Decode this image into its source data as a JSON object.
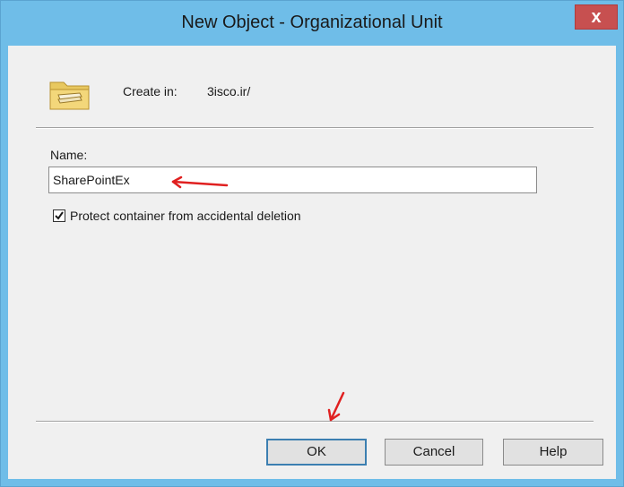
{
  "window": {
    "title": "New Object - Organizational Unit",
    "close_glyph": "x"
  },
  "create_in": {
    "label": "Create in:",
    "value": "3isco.ir/"
  },
  "name_field": {
    "label": "Name:",
    "value": "SharePointEx"
  },
  "protect_checkbox": {
    "label": "Protect container from accidental deletion",
    "checked": true
  },
  "buttons": {
    "ok": "OK",
    "cancel": "Cancel",
    "help": "Help"
  },
  "colors": {
    "titlebar": "#6fbde8",
    "close_button": "#c75050",
    "annotation_arrow": "#e02020"
  },
  "icons": {
    "object_icon": "folder-icon"
  }
}
